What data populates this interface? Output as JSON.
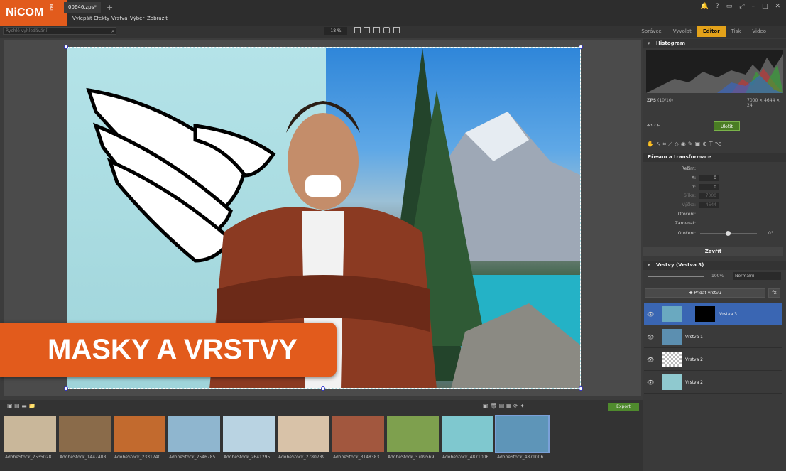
{
  "app": {
    "logo": "NiCOM",
    "logo_sub": "IN.IT",
    "file_tab": "00646.zps*"
  },
  "menu": [
    "Vylepšit",
    "Efekty",
    "Vrstva",
    "Výběr",
    "Zobrazit"
  ],
  "search": {
    "placeholder": "Rychlé vyhledávání"
  },
  "zoom": "18 %",
  "modes": [
    "Správce",
    "Vyvolat",
    "Editor",
    "Tisk",
    "Video"
  ],
  "active_mode": "Editor",
  "banner": "MASKY A VRSTVY",
  "histogram": {
    "title": "Histogram",
    "zps": "ZPS",
    "count": "(10/10)",
    "dims": "7000 × 4644 × 24"
  },
  "save_label": "Uložit",
  "transform": {
    "title": "Přesun a transformace",
    "rezim": "Režim:",
    "x_label": "X:",
    "x_val": "0",
    "y_label": "Y:",
    "y_val": "0",
    "sirka_label": "Šířka:",
    "sirka_val": "7000",
    "vyska_label": "Výška:",
    "vyska_val": "4644",
    "otoceni_label": "Otočení:",
    "zarovnat_label": "Zarovnat:",
    "otoceni2_label": "Otočení:",
    "angle": "0°"
  },
  "close_label": "Zavřít",
  "layers": {
    "title": "Vrstvy (Vrstva 3)",
    "opacity": "100%",
    "blend": "Normální",
    "add_label": "Přidat vrstvu",
    "fx": "fx",
    "items": [
      {
        "name": "Vrstva 3",
        "selected": true
      },
      {
        "name": "Vrstva 1",
        "selected": false
      },
      {
        "name": "Vrstva 2",
        "selected": false
      },
      {
        "name": "Vrstva 2",
        "selected": false
      }
    ]
  },
  "filmstrip": {
    "export_label": "Export",
    "thumbs": [
      {
        "label": "AdobeStock_2535028...",
        "color": "#c9b79a"
      },
      {
        "label": "AdobeStock_1447408...",
        "color": "#8a6b4a"
      },
      {
        "label": "AdobeStock_2331740...",
        "color": "#c26a2e"
      },
      {
        "label": "AdobeStock_2546785...",
        "color": "#8fb6cf"
      },
      {
        "label": "AdobeStock_2641295...",
        "color": "#b9d3e2"
      },
      {
        "label": "AdobeStock_2780789...",
        "color": "#d8c2a8"
      },
      {
        "label": "AdobeStock_3148383...",
        "color": "#a2573e"
      },
      {
        "label": "AdobeStock_3709569...",
        "color": "#7ea04e"
      },
      {
        "label": "AdobeStock_4871006...",
        "color": "#7fc8cf"
      },
      {
        "label": "AdobeStock_4871006...",
        "color": "#5e95b8"
      }
    ]
  }
}
